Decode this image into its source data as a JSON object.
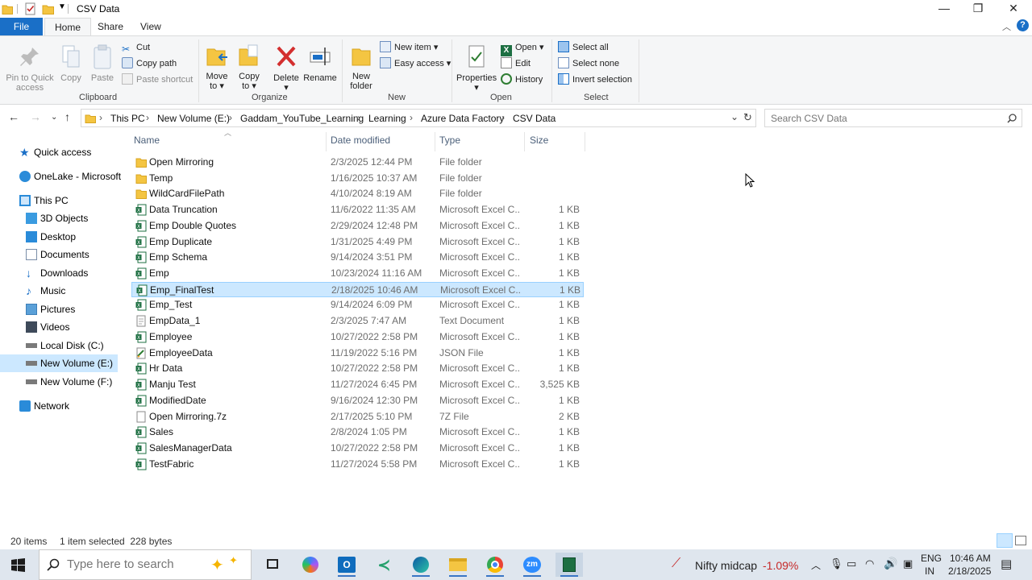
{
  "window": {
    "title": "CSV Data",
    "controls": {
      "minimize": "—",
      "restore": "❐",
      "close": "✕"
    }
  },
  "ribbon_tabs": [
    "File",
    "Home",
    "Share",
    "View"
  ],
  "ribbon": {
    "clipboard": {
      "label": "Clipboard",
      "pin_label_1": "Pin to Quick",
      "pin_label_2": "access",
      "copy": "Copy",
      "paste": "Paste",
      "cut": "Cut",
      "copy_path": "Copy path",
      "paste_shortcut": "Paste shortcut"
    },
    "organize": {
      "label": "Organize",
      "move_1": "Move",
      "move_2": "to",
      "copy_1": "Copy",
      "copy_2": "to",
      "delete": "Delete",
      "rename": "Rename"
    },
    "new": {
      "label": "New",
      "folder_1": "New",
      "folder_2": "folder",
      "new_item": "New item",
      "easy_access": "Easy access"
    },
    "open": {
      "label": "Open",
      "properties": "Properties",
      "open": "Open",
      "edit": "Edit",
      "history": "History"
    },
    "select": {
      "label": "Select",
      "select_all": "Select all",
      "select_none": "Select none",
      "invert": "Invert selection"
    }
  },
  "breadcrumb": [
    "This PC",
    "New Volume (E:)",
    "Gaddam_YouTube_Learning",
    "Learning",
    "Azure Data Factory",
    "CSV Data"
  ],
  "search": {
    "placeholder": "Search CSV Data"
  },
  "nav_pane": {
    "quick_access": "Quick access",
    "onelake": "OneLake - Microsoft",
    "this_pc": "This PC",
    "objects3d": "3D Objects",
    "desktop": "Desktop",
    "documents": "Documents",
    "downloads": "Downloads",
    "music": "Music",
    "pictures": "Pictures",
    "videos": "Videos",
    "local_disk": "Local Disk (C:)",
    "new_volume_e": "New Volume (E:)",
    "new_volume_f": "New Volume (F:)",
    "network": "Network"
  },
  "columns": {
    "name": "Name",
    "date": "Date modified",
    "type": "Type",
    "size": "Size"
  },
  "files": [
    {
      "name": "Open Mirroring",
      "date": "2/3/2025 12:44 PM",
      "type": "File folder",
      "size": "",
      "icon": "folder"
    },
    {
      "name": "Temp",
      "date": "1/16/2025 10:37 AM",
      "type": "File folder",
      "size": "",
      "icon": "folder"
    },
    {
      "name": "WildCardFilePath",
      "date": "4/10/2024 8:19 AM",
      "type": "File folder",
      "size": "",
      "icon": "folder"
    },
    {
      "name": "Data Truncation",
      "date": "11/6/2022 11:35 AM",
      "type": "Microsoft Excel C...",
      "size": "1 KB",
      "icon": "excel"
    },
    {
      "name": "Emp Double Quotes",
      "date": "2/29/2024 12:48 PM",
      "type": "Microsoft Excel C...",
      "size": "1 KB",
      "icon": "excel"
    },
    {
      "name": "Emp Duplicate",
      "date": "1/31/2025 4:49 PM",
      "type": "Microsoft Excel C...",
      "size": "1 KB",
      "icon": "excel"
    },
    {
      "name": "Emp Schema",
      "date": "9/14/2024 3:51 PM",
      "type": "Microsoft Excel C...",
      "size": "1 KB",
      "icon": "excel"
    },
    {
      "name": "Emp",
      "date": "10/23/2024 11:16 AM",
      "type": "Microsoft Excel C...",
      "size": "1 KB",
      "icon": "excel"
    },
    {
      "name": "Emp_FinalTest",
      "date": "2/18/2025 10:46 AM",
      "type": "Microsoft Excel C...",
      "size": "1 KB",
      "icon": "excel",
      "selected": true
    },
    {
      "name": "Emp_Test",
      "date": "9/14/2024 6:09 PM",
      "type": "Microsoft Excel C...",
      "size": "1 KB",
      "icon": "excel"
    },
    {
      "name": "EmpData_1",
      "date": "2/3/2025 7:47 AM",
      "type": "Text Document",
      "size": "1 KB",
      "icon": "text"
    },
    {
      "name": "Employee",
      "date": "10/27/2022 2:58 PM",
      "type": "Microsoft Excel C...",
      "size": "1 KB",
      "icon": "excel"
    },
    {
      "name": "EmployeeData",
      "date": "11/19/2022 5:16 PM",
      "type": "JSON File",
      "size": "1 KB",
      "icon": "json"
    },
    {
      "name": "Hr Data",
      "date": "10/27/2022 2:58 PM",
      "type": "Microsoft Excel C...",
      "size": "1 KB",
      "icon": "excel"
    },
    {
      "name": "Manju Test",
      "date": "11/27/2024 6:45 PM",
      "type": "Microsoft Excel C...",
      "size": "3,525 KB",
      "icon": "excel"
    },
    {
      "name": "ModifiedDate",
      "date": "9/16/2024 12:30 PM",
      "type": "Microsoft Excel C...",
      "size": "1 KB",
      "icon": "excel"
    },
    {
      "name": "Open Mirroring.7z",
      "date": "2/17/2025 5:10 PM",
      "type": "7Z File",
      "size": "2 KB",
      "icon": "blank"
    },
    {
      "name": "Sales",
      "date": "2/8/2024 1:05 PM",
      "type": "Microsoft Excel C...",
      "size": "1 KB",
      "icon": "excel"
    },
    {
      "name": "SalesManagerData",
      "date": "10/27/2022 2:58 PM",
      "type": "Microsoft Excel C...",
      "size": "1 KB",
      "icon": "excel"
    },
    {
      "name": "TestFabric",
      "date": "11/27/2024 5:58 PM",
      "type": "Microsoft Excel C...",
      "size": "1 KB",
      "icon": "excel"
    }
  ],
  "status": {
    "item_count": "20 items",
    "selection": "1 item selected  228 bytes"
  },
  "taskbar": {
    "search_placeholder": "Type here to search",
    "stock_name": "Nifty midcap",
    "stock_change": "-1.09%",
    "language_1": "ENG",
    "language_2": "IN",
    "time": "10:46 AM",
    "date": "2/18/2025"
  },
  "colors": {
    "accent": "#1a6fc7",
    "selection_bg": "#cce8ff",
    "selection_border": "#99d1ff",
    "folder": "#f4c542",
    "excel": "#1d6f42",
    "stock_negative": "#c62828"
  }
}
